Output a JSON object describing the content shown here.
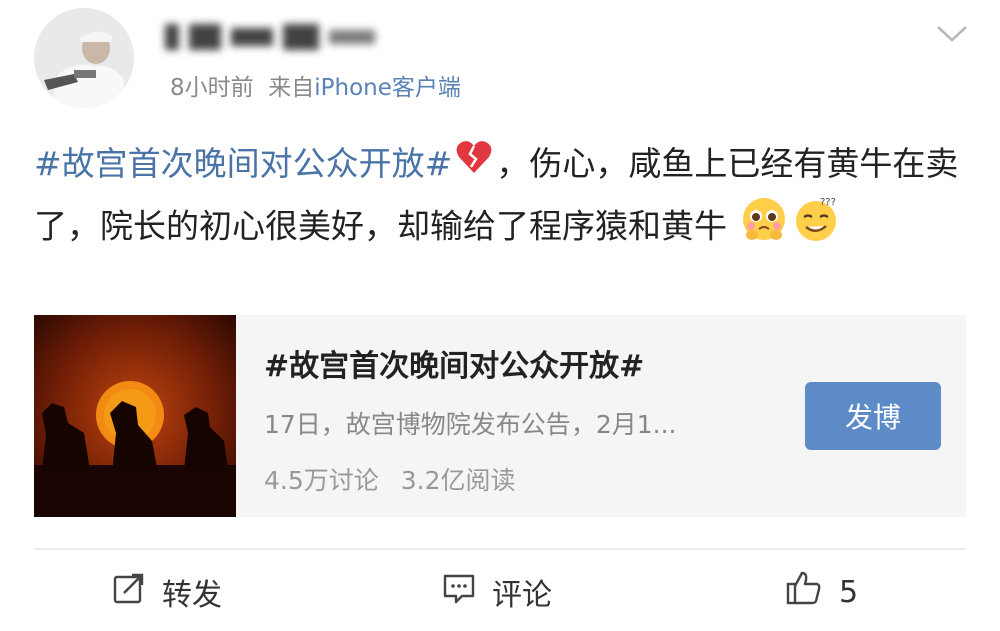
{
  "post": {
    "meta_time": "8小时前",
    "meta_from": "来自",
    "meta_source": "iPhone客户端",
    "text": {
      "topic": "#故宫首次晚间对公众开放#",
      "emoji_broken_heart": "broken-heart-emoji",
      "body": "，伤心，咸鱼上已经有黄牛在卖了，院长的初心很美好，却输给了程序猿和黄牛",
      "emoji_1": "pleading-face-emoji",
      "emoji_2": "confused-face-emoji"
    }
  },
  "card": {
    "title": "#故宫首次晚间对公众开放#",
    "description": "17日，故宫博物院发布公告，2月1...",
    "discussions": "4.5万讨论",
    "reads": "3.2亿阅读",
    "button_label": "发博"
  },
  "actions": {
    "repost_label": "转发",
    "comment_label": "评论",
    "like_count": "5"
  },
  "icons": {
    "menu": "chevron-down-icon",
    "repost": "repost-icon",
    "comment": "comment-icon",
    "like": "thumbs-up-icon"
  },
  "colors": {
    "link_blue": "#4a74a8",
    "button_blue": "#5c8bc8",
    "meta_gray": "#8a8a8a"
  }
}
